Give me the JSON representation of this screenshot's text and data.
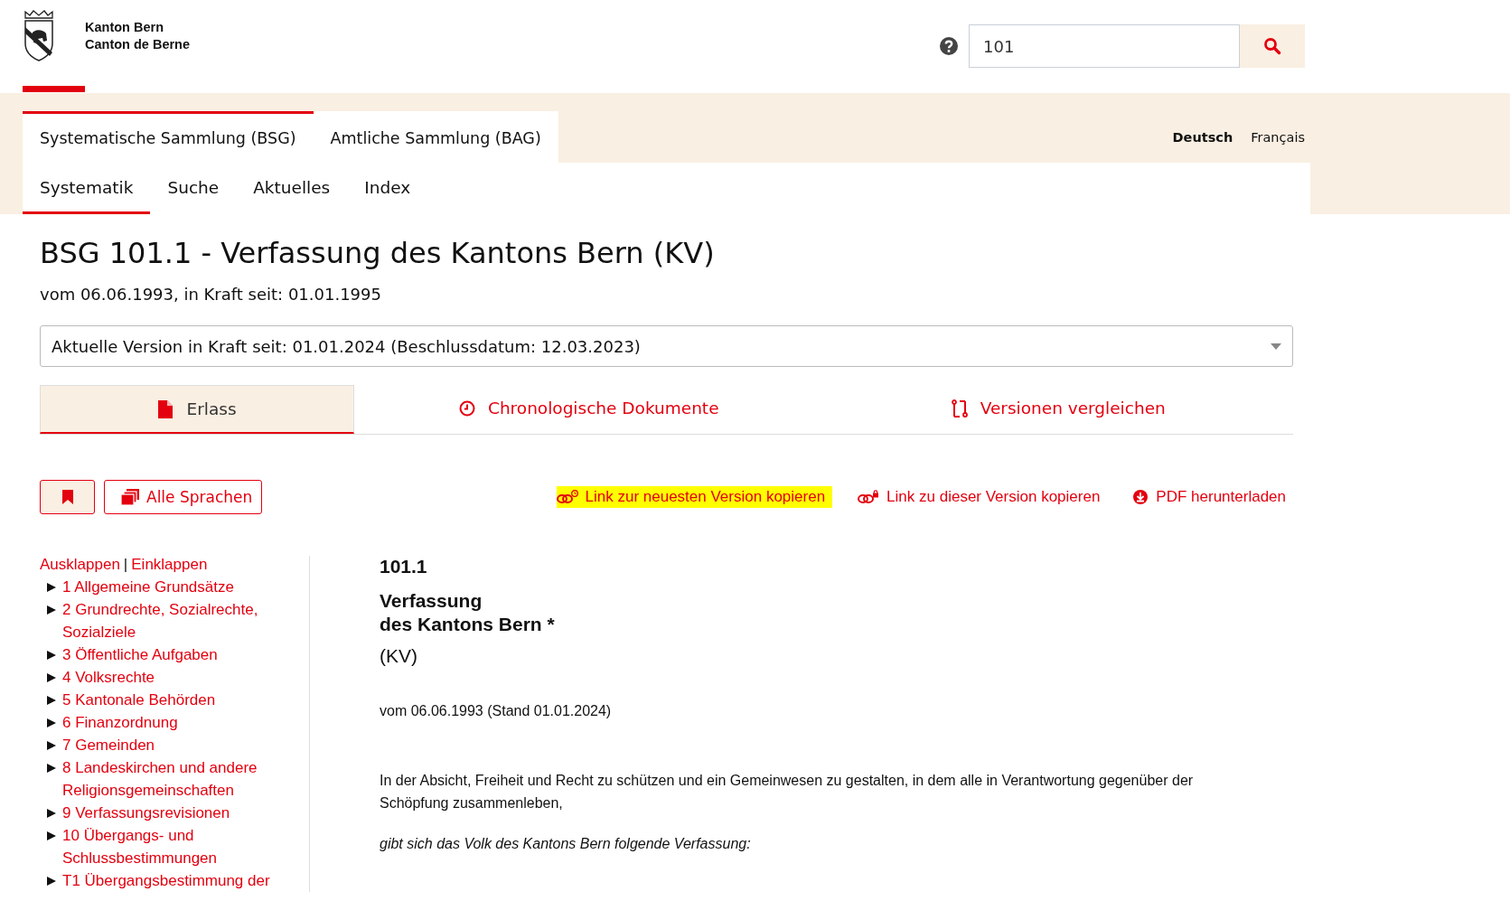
{
  "header": {
    "logo_lines": [
      "Kanton Bern",
      "Canton de Berne"
    ],
    "search": {
      "value": "101"
    }
  },
  "collections": [
    {
      "label": "Systematische Sammlung (BSG)",
      "selected": true
    },
    {
      "label": "Amtliche Sammlung (BAG)",
      "selected": false
    }
  ],
  "languages": [
    {
      "label": "Deutsch",
      "selected": true
    },
    {
      "label": "Français",
      "selected": false
    }
  ],
  "subnav": [
    {
      "label": "Systematik",
      "selected": true
    },
    {
      "label": "Suche",
      "selected": false
    },
    {
      "label": "Aktuelles",
      "selected": false
    },
    {
      "label": "Index",
      "selected": false
    }
  ],
  "title": "BSG 101.1 - Verfassung des Kantons Bern (KV)",
  "subtitle": "vom 06.06.1993, in Kraft seit: 01.01.1995",
  "version_select": {
    "value": "Aktuelle Version in Kraft seit: 01.01.2024 (Beschlussdatum: 12.03.2023)"
  },
  "doc_tabs": [
    {
      "label": "Erlass",
      "kind": "file",
      "selected": true
    },
    {
      "label": "Chronologische Dokumente",
      "kind": "clock",
      "selected": false
    },
    {
      "label": "Versionen vergleichen",
      "kind": "compare",
      "selected": false
    }
  ],
  "buttons": [
    {
      "kind": "bookmark"
    },
    {
      "kind": "copies",
      "label": "Alle Sprachen"
    }
  ],
  "actions": [
    {
      "label": "Link zur neuesten Version kopieren",
      "kind": "link-clock",
      "highlighted": true
    },
    {
      "label": "Link zu dieser Version kopieren",
      "kind": "link-lock",
      "highlighted": false
    },
    {
      "label": "PDF herunterladen",
      "kind": "download",
      "highlighted": false
    }
  ],
  "tree_controls": {
    "expand": "Ausklappen",
    "separator": "|",
    "collapse": "Einklappen"
  },
  "tree": [
    {
      "label": "1 Allgemeine Grundsätze",
      "expanded": false
    },
    {
      "label": "2 Grundrechte, Sozialrechte, Sozialziele",
      "expanded": false
    },
    {
      "label": "3 Öffentliche Aufgaben",
      "expanded": false
    },
    {
      "label": "4 Volksrechte",
      "expanded": false
    },
    {
      "label": "5 Kantonale Behörden",
      "expanded": false
    },
    {
      "label": "6 Finanzordnung",
      "expanded": false
    },
    {
      "label": "7 Gemeinden",
      "expanded": false
    },
    {
      "label": "8 Landeskirchen und andere Religionsgemeinschaften",
      "expanded": false
    },
    {
      "label": "9 Verfassungsrevisionen",
      "expanded": false
    },
    {
      "label": "10 Übergangs- und Schlussbestimmungen",
      "expanded": false
    },
    {
      "label": "T1 Übergangsbestimmung der",
      "expanded": false
    }
  ],
  "document": {
    "number": "101.1",
    "title_lines": [
      "Verfassung",
      "des Kantons Bern *"
    ],
    "abbreviation": "(KV)",
    "date": "vom 06.06.1993 (Stand 01.01.2024)",
    "paragraphs": [
      {
        "kind": "normal",
        "text": "In der Absicht, Freiheit und Recht zu schützen und ein Gemeinwesen zu gestalten, in dem alle in Verantwortung gegenüber der Schöpfung zusammenleben,"
      },
      {
        "kind": "italic",
        "text": "gibt sich das Volk des Kantons Bern folgende Verfassung:"
      }
    ]
  }
}
